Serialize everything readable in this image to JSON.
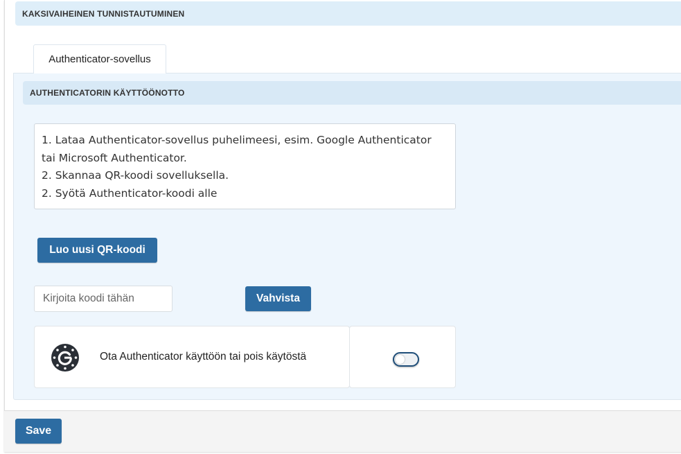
{
  "section": {
    "title": "KAKSIVAIHEINEN TUNNISTAUTUMINEN"
  },
  "tabs": [
    {
      "label": "Authenticator-sovellus"
    }
  ],
  "panel": {
    "title": "AUTHENTICATORIN KÄYTTÖÖNOTTO",
    "instructions": [
      "1. Lataa Authenticator-sovellus puhelimeesi, esim. Google Authenticator tai Microsoft Authenticator.",
      "2. Skannaa QR-koodi sovelluksella.",
      "2. Syötä Authenticator-koodi alle"
    ],
    "qr_button_label": "Luo uusi QR-koodi",
    "code_input": {
      "placeholder": "Kirjoita koodi tähän",
      "value": ""
    },
    "verify_button_label": "Vahvista",
    "toggle": {
      "icon": "authenticator-icon",
      "label": "Ota Authenticator käyttöön tai pois käytöstä",
      "enabled": false
    }
  },
  "footer": {
    "save_label": "Save"
  },
  "colors": {
    "primary": "#2d6ca2",
    "header_bg": "#deeef9",
    "panel_bg": "#eef6fd"
  }
}
